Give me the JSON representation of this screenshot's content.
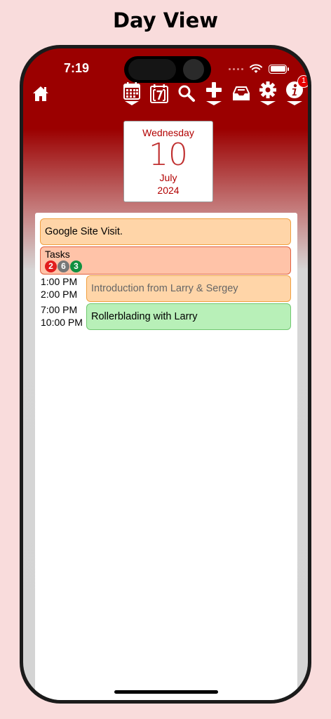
{
  "caption": "Day View",
  "status": {
    "time": "7:19"
  },
  "toolbar": {
    "items": [
      "home-icon",
      "calendar-month-icon",
      "calendar-week-icon",
      "search-icon",
      "add-icon",
      "inbox-icon",
      "settings-icon",
      "info-icon"
    ],
    "info_badge": "1"
  },
  "date": {
    "weekday": "Wednesday",
    "day": "10",
    "month": "July",
    "year": "2024"
  },
  "allday_event": "Google Site Visit.",
  "tasks": {
    "label": "Tasks",
    "counts": [
      "2",
      "6",
      "3"
    ]
  },
  "events": [
    {
      "start": "1:00 PM",
      "end": "2:00 PM",
      "title": "Introduction from Larry & Sergey"
    },
    {
      "start": "7:00 PM",
      "end": "10:00 PM",
      "title": "Rollerblading with Larry"
    }
  ],
  "colors": {
    "header": "#9b0000",
    "event_orange": "#ffd5a8",
    "event_green": "#b8f0b8",
    "tasks_bg": "#ffc3a8"
  }
}
